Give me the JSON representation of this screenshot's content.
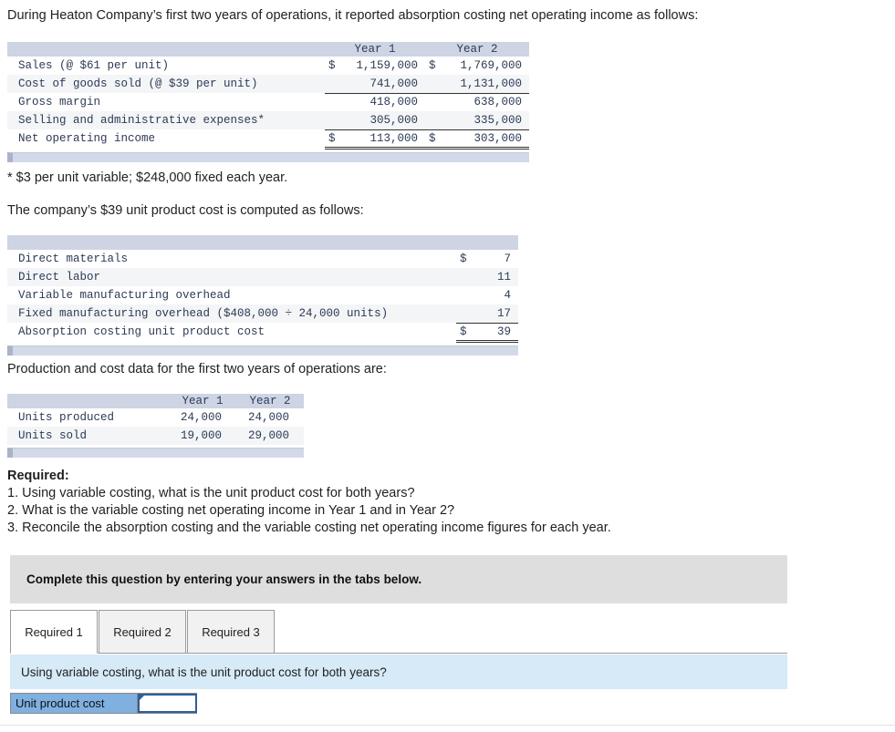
{
  "intro": "During Heaton Company’s first two years of operations, it reported absorption costing net operating income as follows:",
  "income_statement": {
    "columns": [
      "",
      "Year 1",
      "Year 2"
    ],
    "rows": [
      {
        "label": "Sales (@ $61 per unit)",
        "y1_cur": "$",
        "y1": "1,159,000",
        "y2_cur": "$",
        "y2": "1,769,000",
        "rule": "none"
      },
      {
        "label": "Cost of goods sold (@ $39 per unit)",
        "y1_cur": "",
        "y1": "741,000",
        "y2_cur": "",
        "y2": "1,131,000",
        "rule": "single"
      },
      {
        "label": "Gross margin",
        "y1_cur": "",
        "y1": "418,000",
        "y2_cur": "",
        "y2": "638,000",
        "rule": "none"
      },
      {
        "label": "Selling and administrative expenses*",
        "y1_cur": "",
        "y1": "305,000",
        "y2_cur": "",
        "y2": "335,000",
        "rule": "single"
      },
      {
        "label": "Net operating income",
        "y1_cur": "$",
        "y1": "113,000",
        "y2_cur": "$",
        "y2": "303,000",
        "rule": "double"
      }
    ]
  },
  "footnote": "* $3 per unit variable; $248,000 fixed each year.",
  "lead2": "The company’s $39 unit product cost is computed as follows:",
  "product_cost": {
    "rows": [
      {
        "label": "Direct materials",
        "cur": "$",
        "value": "7",
        "rule": "none"
      },
      {
        "label": "Direct labor",
        "cur": "",
        "value": "11",
        "rule": "none"
      },
      {
        "label": "Variable manufacturing overhead",
        "cur": "",
        "value": "4",
        "rule": "none"
      },
      {
        "label": "Fixed manufacturing overhead ($408,000 ÷ 24,000 units)",
        "cur": "",
        "value": "17",
        "rule": "single"
      },
      {
        "label": "Absorption costing unit product cost",
        "cur": "$",
        "value": "39",
        "rule": "double"
      }
    ]
  },
  "lead3": "Production and cost data for the first two years of operations are:",
  "units": {
    "columns": [
      "",
      "Year 1",
      "Year 2"
    ],
    "rows": [
      {
        "label": "Units produced",
        "y1": "24,000",
        "y2": "24,000"
      },
      {
        "label": "Units sold",
        "y1": "19,000",
        "y2": "29,000"
      }
    ]
  },
  "required": {
    "heading": "Required:",
    "items": [
      "1. Using variable costing, what is the unit product cost for both years?",
      "2. What is the variable costing net operating income in Year 1 and in Year 2?",
      "3. Reconcile the absorption costing and the variable costing net operating income figures for each year."
    ]
  },
  "banner": "Complete this question by entering your answers in the tabs below.",
  "tabs": [
    {
      "label": "Required 1",
      "active": true
    },
    {
      "label": "Required 2",
      "active": false
    },
    {
      "label": "Required 3",
      "active": false
    }
  ],
  "question_strip": "Using variable costing, what is the unit product cost for both years?",
  "answer_row": {
    "label": "Unit product cost",
    "value": "",
    "placeholder": ""
  },
  "colors": {
    "table_header": "#ced4e4",
    "table_cap": "#d3d9e8",
    "banner_gray": "#dedede",
    "question_blue": "#d7eaf8",
    "answer_blue": "#7fb0e0",
    "input_border": "#2f5d9e"
  }
}
